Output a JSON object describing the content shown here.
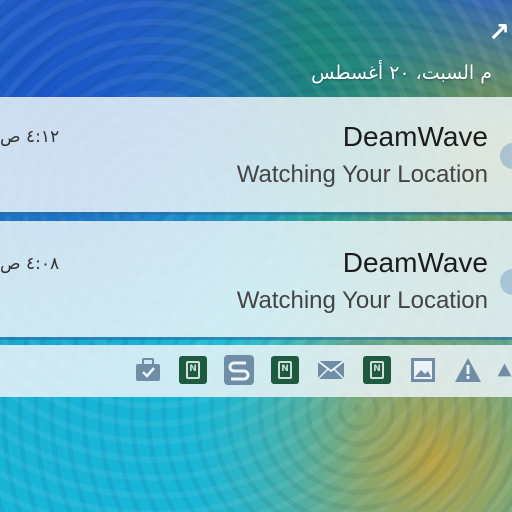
{
  "status_bar": {
    "date_text": "م  السبت، ٢٠ أغسطس"
  },
  "notifications": [
    {
      "title": "DeamWave",
      "text": "Watching Your Location",
      "time": "٤:١٢ ص"
    },
    {
      "title": "DeamWave",
      "text": "Watching Your Location",
      "time": "٤:٠٨ ص"
    }
  ],
  "tray_icons": [
    "briefcase-icon",
    "nfc-tag-icon",
    "s-app-icon",
    "nfc-tag-icon",
    "mail-icon",
    "nfc-tag-icon",
    "image-icon",
    "warning-icon",
    "warning-icon"
  ],
  "colors": {
    "card_bg": "#ebf3f8",
    "icon_gray": "#6f8ea6",
    "nfc_green": "#1e5a40"
  }
}
